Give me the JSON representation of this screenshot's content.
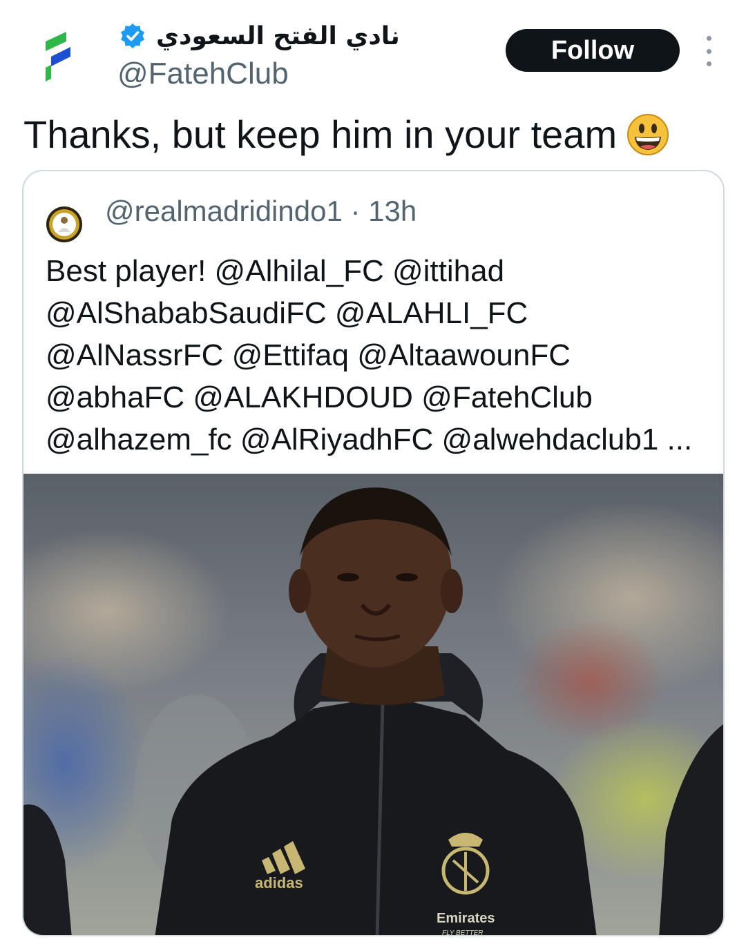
{
  "header": {
    "display_name": "نادي الفتح السعودي",
    "handle": "@FatehClub",
    "follow_label": "Follow",
    "verified_icon": "verified-badge-icon",
    "more_icon": "more-vertical-icon"
  },
  "tweet": {
    "text": "Thanks, but keep him in your team",
    "emoji": "grinning-face-emoji"
  },
  "quote": {
    "handle": "@realmadridindo1",
    "separator": "·",
    "time": "13h",
    "lines": [
      "Best player! @Alhilal_FC @ittihad",
      "@AlShababSaudiFC @ALAHLI_FC",
      "@AlNassrFC @Ettifaq @AltaawounFC",
      "@abhaFC @ALAKHDOUD @FatehClub",
      "@alhazem_fc @AlRiyadhFC @alwehdaclub1 ..."
    ],
    "image": {
      "description_icon": "player-photo",
      "sponsor_brand": "adidas",
      "shirt_sponsor": "Emirates",
      "shirt_sponsor_tagline": "FLY BETTER"
    }
  },
  "colors": {
    "text_primary": "#0f1419",
    "text_secondary": "#536471",
    "border": "#cfd9de",
    "verified_blue": "#1d9bf0",
    "fateh_green": "#2eb84a",
    "fateh_blue": "#1f4fd1"
  }
}
